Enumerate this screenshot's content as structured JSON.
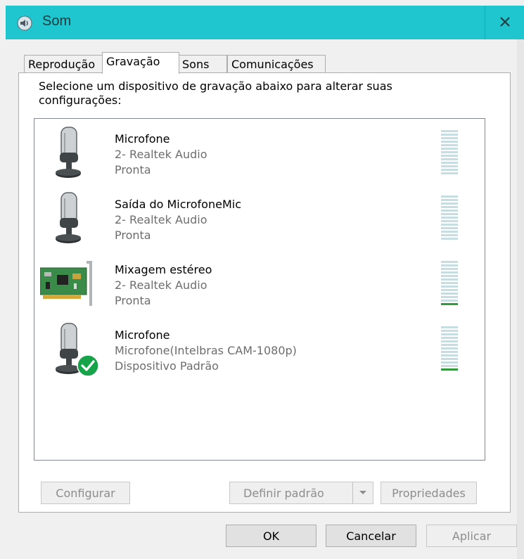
{
  "window": {
    "title": "Som"
  },
  "tabs": [
    {
      "label": "Reprodução"
    },
    {
      "label": "Gravação"
    },
    {
      "label": "Sons"
    },
    {
      "label": "Comunicações"
    }
  ],
  "instruction": "Selecione um dispositivo de gravação abaixo para alterar suas configurações:",
  "devices": [
    {
      "name": "Microfone",
      "driver": "2- Realtek Audio",
      "status": "Pronta",
      "icon": "microphone-icon",
      "level": 0
    },
    {
      "name": "Saída do MicrofoneMic",
      "driver": "2- Realtek Audio",
      "status": "Pronta",
      "icon": "microphone-icon",
      "level": 0
    },
    {
      "name": "Mixagem estéreo",
      "driver": "2- Realtek Audio",
      "status": "Pronta",
      "icon": "sound-card-icon",
      "level": 0.06
    },
    {
      "name": "Microfone",
      "driver": "Microfone(Intelbras CAM-1080p)",
      "status": "Dispositivo Padrão",
      "icon": "microphone-default-icon",
      "level": 0.06
    }
  ],
  "panel_buttons": {
    "configure": "Configurar",
    "set_default": "Definir padrão",
    "properties": "Propriedades"
  },
  "dialog_buttons": {
    "ok": "OK",
    "cancel": "Cancelar",
    "apply": "Aplicar"
  },
  "colors": {
    "titlebar": "#1fc6cf",
    "meter_on": "#2f9b3a",
    "meter_off": "#c7dde4",
    "default_check": "#16a34a"
  }
}
